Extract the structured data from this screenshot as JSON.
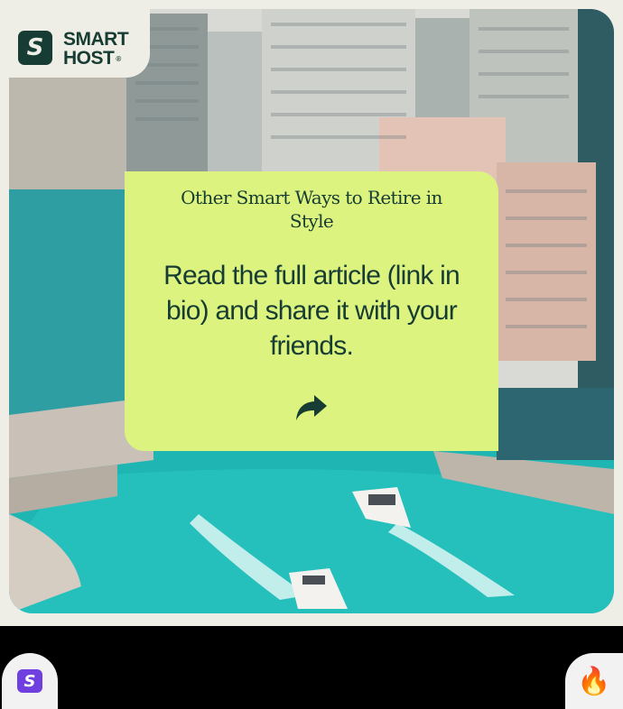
{
  "brand": {
    "name_line1": "SMART",
    "name_line2": "HOST",
    "registered": "®",
    "logo_letter": "S",
    "color_dark": "#173c33",
    "color_cream": "#efeee6"
  },
  "card": {
    "heading": "Other Smart Ways to Retire in Style",
    "body": "Read the full article (link in bio) and share it with your friends.",
    "share_icon": "share-arrow-icon",
    "background": "#dcf37f"
  },
  "bottom_bar": {
    "avatar_letter": "S",
    "avatar_color": "#6f3fe0",
    "reaction_emoji": "🔥"
  }
}
